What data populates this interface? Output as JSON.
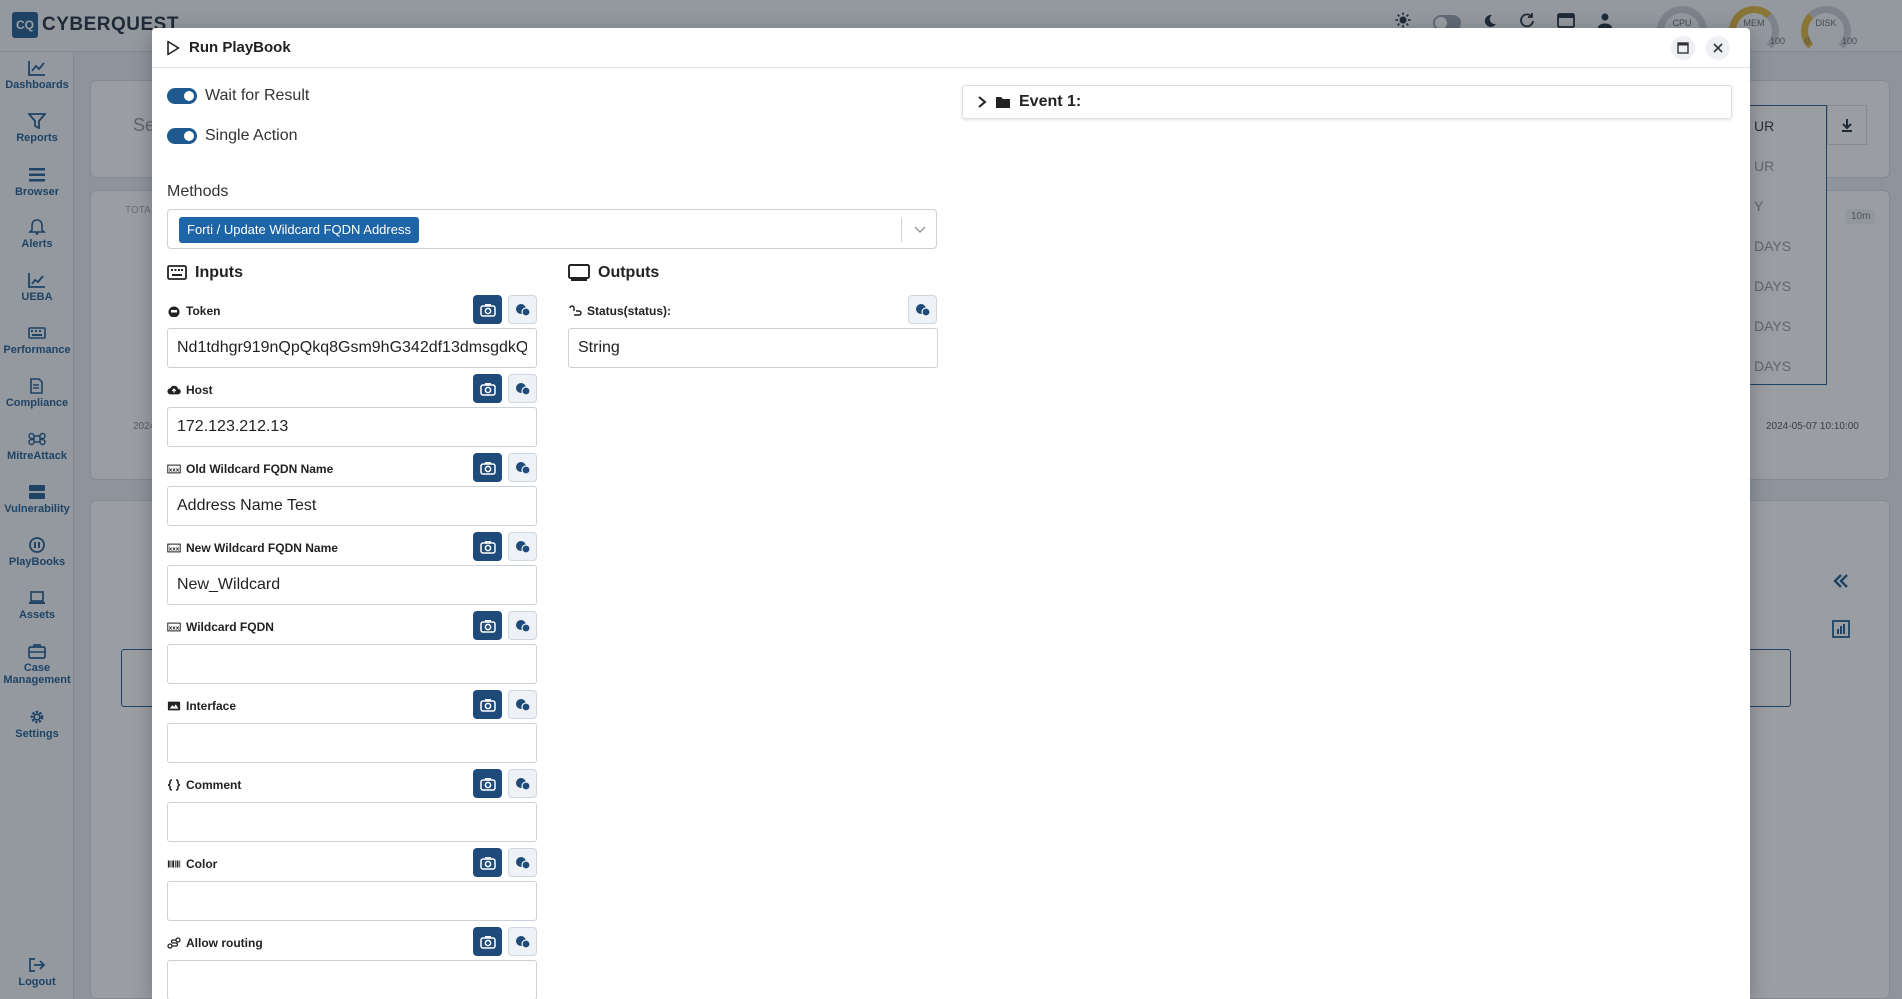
{
  "app": {
    "logo_mark": "CQ",
    "logo_text": "CYBERQUEST",
    "gauges": [
      {
        "label": "CPU",
        "min": "",
        "max": ""
      },
      {
        "label": "MEM",
        "min": "",
        "max": "100"
      },
      {
        "label": "DISK",
        "min": "0",
        "max": "100"
      }
    ]
  },
  "sidebar": {
    "items": [
      {
        "label": "Dashboards",
        "icon": "dashboard-icon"
      },
      {
        "label": "Reports",
        "icon": "filter-icon"
      },
      {
        "label": "Browser",
        "icon": "list-icon"
      },
      {
        "label": "Alerts",
        "icon": "bell-icon"
      },
      {
        "label": "UEBA",
        "icon": "chart-line-icon"
      },
      {
        "label": "Performance",
        "icon": "keyboard-icon"
      },
      {
        "label": "Compliance",
        "icon": "document-edit-icon"
      },
      {
        "label": "MitreAttack",
        "icon": "command-icon"
      },
      {
        "label": "Vulnerability",
        "icon": "server-icon"
      },
      {
        "label": "PlayBooks",
        "icon": "playbook-icon"
      },
      {
        "label": "Assets",
        "icon": "laptop-icon"
      },
      {
        "label": "Case Management",
        "icon": "briefcase-icon"
      },
      {
        "label": "Settings",
        "icon": "gear-icon"
      }
    ],
    "logout_label": "Logout"
  },
  "background": {
    "search_placeholder_fragment": "Se",
    "total_fragment": "TOTA",
    "date_fragment": "2024",
    "timestamp": "2024-05-07 10:10:00",
    "range_options": [
      "UR",
      "UR",
      "Y",
      "DAYS",
      "DAYS",
      "DAYS",
      "DAYS"
    ],
    "range_badge": "10m"
  },
  "modal": {
    "title": "Run PlayBook",
    "toggles": [
      {
        "label": "Wait for Result",
        "on": true
      },
      {
        "label": "Single Action",
        "on": true
      }
    ],
    "methods_label": "Methods",
    "selected_method": "Forti / Update Wildcard FQDN Address",
    "inputs_title": "Inputs",
    "outputs_title": "Outputs",
    "fields": [
      {
        "label": "Token",
        "icon": "helmet-icon",
        "value": "Nd1tdhgr919nQpQkq8Gsm9hG342df13dmsgdkQ"
      },
      {
        "label": "Host",
        "icon": "cloud-upload-icon",
        "value": "172.123.212.13"
      },
      {
        "label": "Old Wildcard FQDN Name",
        "icon": "text-field-icon",
        "value": "Address Name Test"
      },
      {
        "label": "New Wildcard FQDN Name",
        "icon": "text-field-icon",
        "value": "New_Wildcard"
      },
      {
        "label": "Wildcard FQDN",
        "icon": "text-field-icon",
        "value": ""
      },
      {
        "label": "Interface",
        "icon": "image-icon",
        "value": ""
      },
      {
        "label": "Comment",
        "icon": "braces-icon",
        "value": ""
      },
      {
        "label": "Color",
        "icon": "barcode-icon",
        "value": ""
      },
      {
        "label": "Allow routing",
        "icon": "route-icon",
        "value": ""
      }
    ],
    "outputs": [
      {
        "label": "Status(status):",
        "icon": "link-icon",
        "value": "String"
      }
    ],
    "event_label": "Event 1:"
  }
}
